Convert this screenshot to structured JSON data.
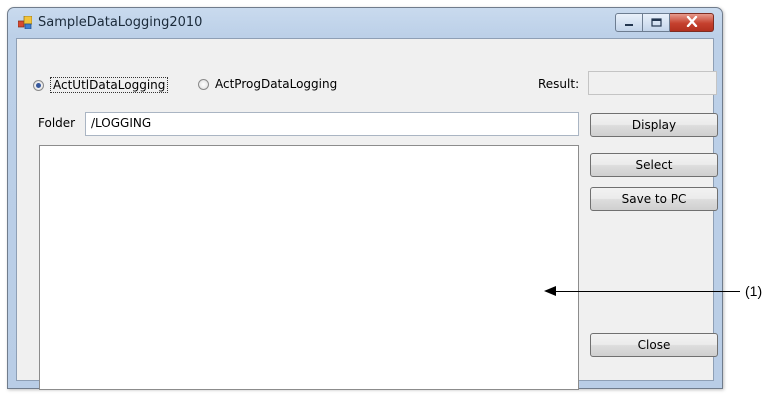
{
  "window": {
    "title": "SampleDataLogging2010"
  },
  "radios": [
    {
      "label": "ActUtlDataLogging",
      "selected": true
    },
    {
      "label": "ActProgDataLogging",
      "selected": false
    }
  ],
  "result": {
    "label": "Result:",
    "value": ""
  },
  "folder": {
    "label": "Folder",
    "value": "/LOGGING"
  },
  "buttons": {
    "display": "Display",
    "select": "Select",
    "save_to_pc": "Save to PC",
    "close": "Close"
  },
  "annotation": {
    "label": "(1)"
  },
  "colors": {
    "titlebar": "#c9daee",
    "client_bg": "#f0f0f0",
    "radio_selected": "#35579c",
    "close_button": "#c5412e"
  },
  "icons": {
    "app": "app-window-icon",
    "minimize": "minimize-icon",
    "maximize": "maximize-icon",
    "close": "close-icon"
  }
}
